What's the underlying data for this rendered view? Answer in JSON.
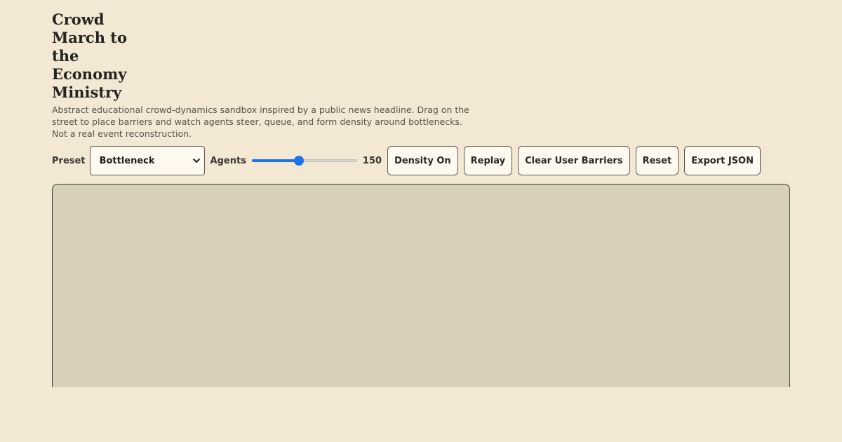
{
  "header": {
    "title": "Crowd March to the Economy Ministry",
    "description": "Abstract educational crowd-dynamics sandbox inspired by a public news headline. Drag on the street to place barriers and watch agents steer, queue, and form density around bottlenecks. Not a real event reconstruction."
  },
  "controls": {
    "preset_label": "Preset",
    "preset_value": "Bottleneck",
    "agents_label": "Agents",
    "agents_value": "150",
    "agents_fraction": 0.44,
    "density_button": "Density On",
    "replay_button": "Replay",
    "clear_button": "Clear User Barriers",
    "reset_button": "Reset",
    "export_button": "Export JSON"
  },
  "colors": {
    "page_background": "#f3e8d3",
    "canvas_background": "#d8d0b8",
    "slider_accent": "#1a73e8",
    "button_background": "#fffaf0"
  },
  "icons": {
    "preset_dropdown": "chevron-down-icon"
  }
}
